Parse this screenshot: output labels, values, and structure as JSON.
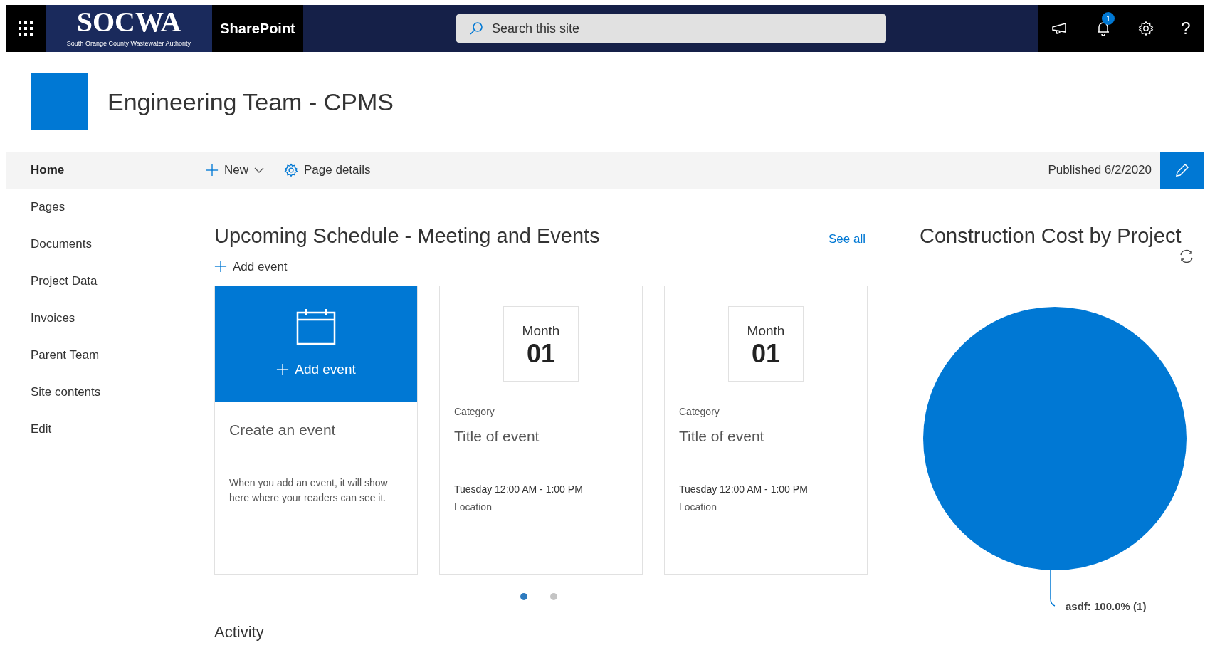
{
  "suite_bar": {
    "org_name": "SOCWA",
    "org_subtitle": "South Orange County Wastewater Authority",
    "app_name": "SharePoint",
    "search": {
      "placeholder": "Search this site"
    },
    "notification_count": "1",
    "help": "?"
  },
  "site": {
    "title": "Engineering Team - CPMS"
  },
  "nav": [
    {
      "label": "Home",
      "selected": true
    },
    {
      "label": "Pages",
      "selected": false
    },
    {
      "label": "Documents",
      "selected": false
    },
    {
      "label": "Project Data",
      "selected": false
    },
    {
      "label": "Invoices",
      "selected": false
    },
    {
      "label": "Parent Team",
      "selected": false
    },
    {
      "label": "Site contents",
      "selected": false
    },
    {
      "label": "Edit",
      "selected": false
    }
  ],
  "command_bar": {
    "new": "New",
    "page_details": "Page details",
    "published": "Published 6/2/2020"
  },
  "events": {
    "title": "Upcoming Schedule - Meeting and Events",
    "see_all": "See all",
    "add_event": "Add event",
    "cards": [
      {
        "kind": "add",
        "button": "Add event",
        "title": "Create an event",
        "text": "When you add an event, it will show here where your readers can see it."
      },
      {
        "kind": "event",
        "month": "Month",
        "day": "01",
        "category": "Category",
        "title": "Title of event",
        "time": "Tuesday 12:00 AM - 1:00 PM",
        "location": "Location"
      },
      {
        "kind": "event",
        "month": "Month",
        "day": "01",
        "category": "Category",
        "title": "Title of event",
        "time": "Tuesday 12:00 AM - 1:00 PM",
        "location": "Location"
      }
    ],
    "pages": [
      {
        "selected": true
      },
      {
        "selected": false
      }
    ]
  },
  "chart": {
    "title": "Construction Cost by Project",
    "chart_data": {
      "type": "pie",
      "values": [
        1
      ],
      "value_labels": [
        "asdf: 100.0% (1)"
      ]
    }
  },
  "activity": {
    "title": "Activity"
  }
}
